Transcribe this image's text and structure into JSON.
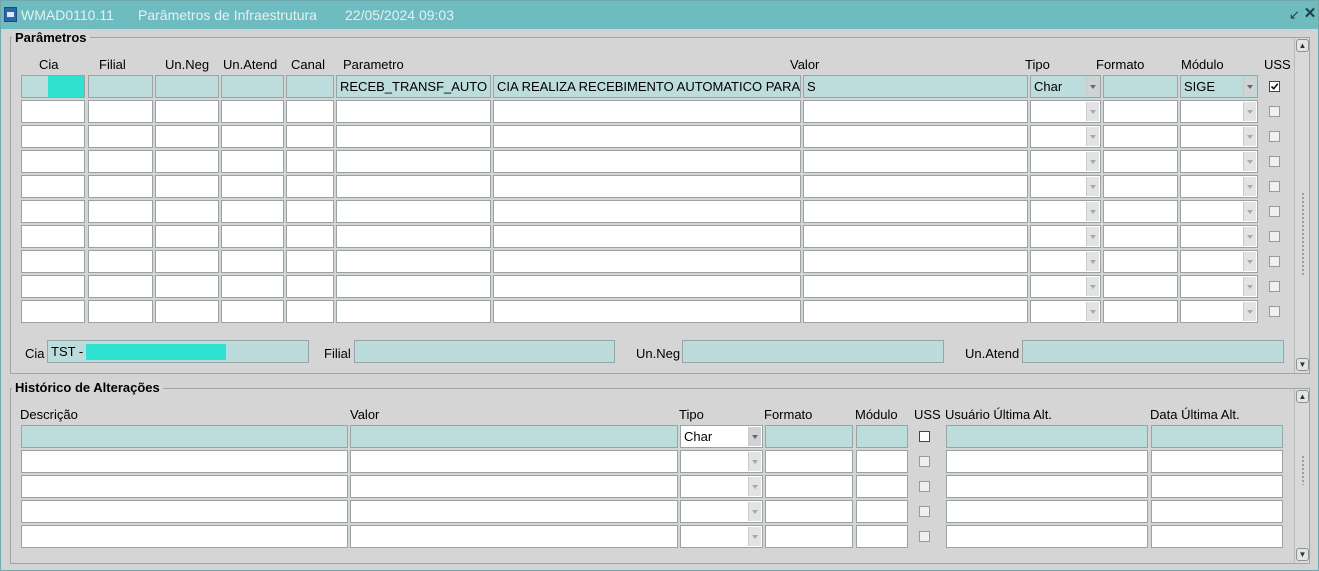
{
  "window": {
    "code": "WMAD0110.11",
    "name": "Parâmetros de Infraestrutura",
    "datetime": "22/05/2024 09:03"
  },
  "parametros": {
    "section_title": "Parâmetros",
    "headers": {
      "cia": "Cia",
      "filial": "Filial",
      "un_neg": "Un.Neg",
      "un_atend": "Un.Atend",
      "canal": "Canal",
      "parametro": "Parametro",
      "valor": "Valor",
      "tipo": "Tipo",
      "formato": "Formato",
      "modulo": "Módulo",
      "uss": "USS"
    },
    "rows": [
      {
        "cia": "",
        "filial": "",
        "un_neg": "",
        "un_atend": "",
        "canal": "",
        "parametro": "RECEB_TRANSF_AUTO",
        "descricao": "CIA REALIZA RECEBIMENTO AUTOMATICO PARA",
        "valor": "S",
        "tipo": "Char",
        "formato": "",
        "modulo": "SIGE",
        "uss": true
      },
      {
        "cia": "",
        "filial": "",
        "un_neg": "",
        "un_atend": "",
        "canal": "",
        "parametro": "",
        "descricao": "",
        "valor": "",
        "tipo": "",
        "formato": "",
        "modulo": "",
        "uss": false
      },
      {
        "cia": "",
        "filial": "",
        "un_neg": "",
        "un_atend": "",
        "canal": "",
        "parametro": "",
        "descricao": "",
        "valor": "",
        "tipo": "",
        "formato": "",
        "modulo": "",
        "uss": false
      },
      {
        "cia": "",
        "filial": "",
        "un_neg": "",
        "un_atend": "",
        "canal": "",
        "parametro": "",
        "descricao": "",
        "valor": "",
        "tipo": "",
        "formato": "",
        "modulo": "",
        "uss": false
      },
      {
        "cia": "",
        "filial": "",
        "un_neg": "",
        "un_atend": "",
        "canal": "",
        "parametro": "",
        "descricao": "",
        "valor": "",
        "tipo": "",
        "formato": "",
        "modulo": "",
        "uss": false
      },
      {
        "cia": "",
        "filial": "",
        "un_neg": "",
        "un_atend": "",
        "canal": "",
        "parametro": "",
        "descricao": "",
        "valor": "",
        "tipo": "",
        "formato": "",
        "modulo": "",
        "uss": false
      },
      {
        "cia": "",
        "filial": "",
        "un_neg": "",
        "un_atend": "",
        "canal": "",
        "parametro": "",
        "descricao": "",
        "valor": "",
        "tipo": "",
        "formato": "",
        "modulo": "",
        "uss": false
      },
      {
        "cia": "",
        "filial": "",
        "un_neg": "",
        "un_atend": "",
        "canal": "",
        "parametro": "",
        "descricao": "",
        "valor": "",
        "tipo": "",
        "formato": "",
        "modulo": "",
        "uss": false
      },
      {
        "cia": "",
        "filial": "",
        "un_neg": "",
        "un_atend": "",
        "canal": "",
        "parametro": "",
        "descricao": "",
        "valor": "",
        "tipo": "",
        "formato": "",
        "modulo": "",
        "uss": false
      },
      {
        "cia": "",
        "filial": "",
        "un_neg": "",
        "un_atend": "",
        "canal": "",
        "parametro": "",
        "descricao": "",
        "valor": "",
        "tipo": "",
        "formato": "",
        "modulo": "",
        "uss": false
      }
    ],
    "detail": {
      "cia_label": "Cia",
      "cia_value": "TST -",
      "filial_label": "Filial",
      "filial_value": "",
      "un_neg_label": "Un.Neg",
      "un_neg_value": "",
      "un_atend_label": "Un.Atend",
      "un_atend_value": ""
    }
  },
  "historico": {
    "section_title": "Histórico de Alterações",
    "headers": {
      "descricao": "Descrição",
      "valor": "Valor",
      "tipo": "Tipo",
      "formato": "Formato",
      "modulo": "Módulo",
      "uss": "USS",
      "usuario": "Usuário Última Alt.",
      "data": "Data Última Alt."
    },
    "rows": [
      {
        "descricao": "",
        "valor": "",
        "tipo": "Char",
        "formato": "",
        "modulo": "",
        "uss": false,
        "usuario": "",
        "data": ""
      },
      {
        "descricao": "",
        "valor": "",
        "tipo": "",
        "formato": "",
        "modulo": "",
        "uss": false,
        "usuario": "",
        "data": ""
      },
      {
        "descricao": "",
        "valor": "",
        "tipo": "",
        "formato": "",
        "modulo": "",
        "uss": false,
        "usuario": "",
        "data": ""
      },
      {
        "descricao": "",
        "valor": "",
        "tipo": "",
        "formato": "",
        "modulo": "",
        "uss": false,
        "usuario": "",
        "data": ""
      },
      {
        "descricao": "",
        "valor": "",
        "tipo": "",
        "formato": "",
        "modulo": "",
        "uss": false,
        "usuario": "",
        "data": ""
      }
    ]
  },
  "colors": {
    "titlebar": "#6fbcc0",
    "current_record": "#bddcdc",
    "highlight": "#2fe3d0"
  },
  "icons": {
    "app": "form-icon",
    "minimize": "minimize-icon",
    "close": "close-icon",
    "scroll_up": "arrow-up-icon",
    "scroll_down": "arrow-down-icon"
  }
}
